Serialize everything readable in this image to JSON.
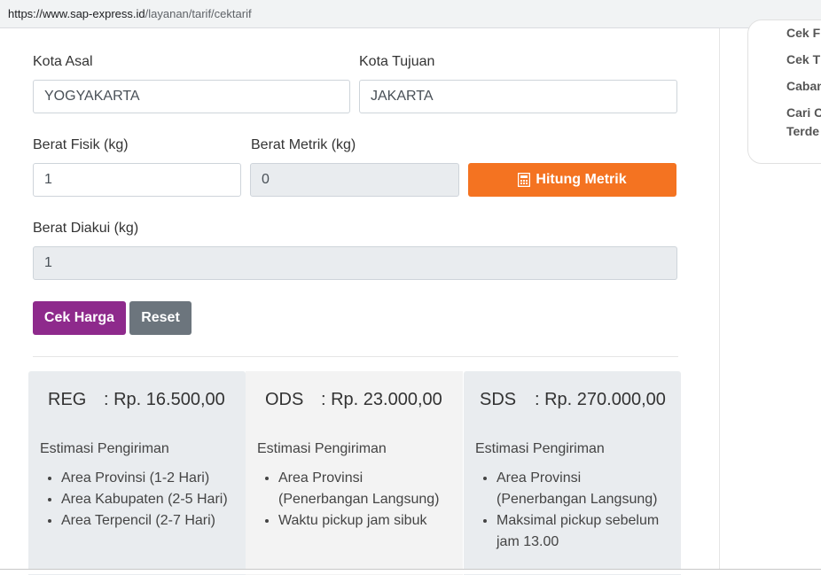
{
  "browser": {
    "url_host": "https://www.sap-express.id",
    "url_path": "/layanan/tarif/cektarif"
  },
  "form": {
    "origin_label": "Kota Asal",
    "origin_value": "YOGYAKARTA",
    "dest_label": "Kota Tujuan",
    "dest_value": "JAKARTA",
    "weight_label": "Berat Fisik (kg)",
    "weight_value": "1",
    "metric_label": "Berat Metrik (kg)",
    "metric_value": "0",
    "metric_button": "Hitung Metrik",
    "accepted_label": "Berat Diakui (kg)",
    "accepted_value": "1",
    "check_button": "Cek Harga",
    "reset_button": "Reset"
  },
  "sidebar": {
    "items": [
      "Cek F",
      "Cek T",
      "Caban",
      "Cari C",
      "Terde"
    ]
  },
  "results": [
    {
      "service": "REG",
      "price": ": Rp. 16.500,00",
      "estimate_label": "Estimasi Pengiriman",
      "items": [
        "Area Provinsi (1-2 Hari)",
        "Area Kabupaten (2-5 Hari)",
        "Area Terpencil (2-7 Hari)"
      ]
    },
    {
      "service": "ODS",
      "price": ": Rp. 23.000,00",
      "estimate_label": "Estimasi Pengiriman",
      "items": [
        "Area Provinsi (Penerbangan Langsung)",
        "Waktu pickup jam sibuk"
      ]
    },
    {
      "service": "SDS",
      "price": ": Rp. 270.000,00",
      "estimate_label": "Estimasi Pengiriman",
      "items": [
        "Area Provinsi (Penerbangan Langsung)",
        "Maksimal pickup sebelum jam 13.00"
      ]
    }
  ],
  "colors": {
    "orange": "#f47321",
    "purple": "#8e2a8c",
    "gray": "#6c757d"
  },
  "icons": {
    "metric_button": "calculator-icon"
  }
}
